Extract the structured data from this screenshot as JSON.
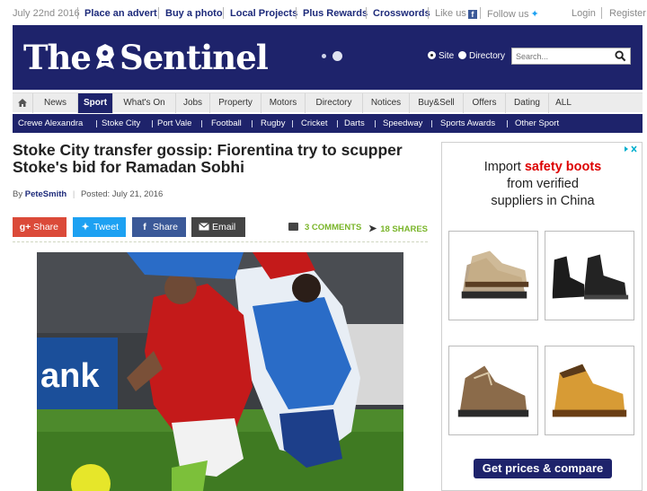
{
  "topbar": {
    "date": "July 22nd 2016",
    "links": [
      "Place an advert",
      "Buy a photo",
      "Local Projects",
      "Plus Rewards",
      "Crosswords"
    ],
    "like_us": "Like us",
    "follow_us": "Follow us",
    "login": "Login",
    "register": "Register"
  },
  "masthead": {
    "logo_text_left": "The",
    "logo_text_right": "Sentinel",
    "search_options": [
      "Site",
      "Directory"
    ],
    "search_selected": "Site",
    "search_placeholder": "Search..."
  },
  "nav": {
    "items": [
      "News",
      "Sport",
      "What's On",
      "Jobs",
      "Property",
      "Motors",
      "Directory",
      "Notices",
      "Buy&Sell",
      "Offers",
      "Dating",
      "ALL"
    ],
    "active": "Sport"
  },
  "subnav": {
    "items": [
      "Crewe Alexandra",
      "Stoke City",
      "Port Vale",
      "Football",
      "Rugby",
      "Cricket",
      "Darts",
      "Speedway",
      "Sports Awards",
      "Other Sport"
    ]
  },
  "article": {
    "headline": "Stoke City transfer gossip: Fiorentina try to scupper Stoke's bid for Ramadan Sobhi",
    "by": "By",
    "author": "PeteSmith",
    "posted": "Posted: July 21, 2016",
    "share_buttons": [
      "Share",
      "Tweet",
      "Share",
      "Email"
    ],
    "comments": "3 COMMENTS",
    "shares": "18 SHARES"
  },
  "ad": {
    "line1_prefix": "Import",
    "line1_highlight": "safety boots",
    "line2": "from verified",
    "line3": "suppliers in China",
    "button": "Get prices & compare"
  },
  "colors": {
    "brand_navy": "#1e236b",
    "accent_green": "#7ab52a",
    "gplus": "#db4a39",
    "twitter": "#1da1f2",
    "facebook": "#3b5998",
    "ad_highlight": "#dd0000"
  },
  "icons": [
    "home-icon",
    "search-icon",
    "facebook-icon",
    "twitter-icon",
    "comment-icon",
    "share-icon",
    "email-icon",
    "adchoices-icon"
  ]
}
